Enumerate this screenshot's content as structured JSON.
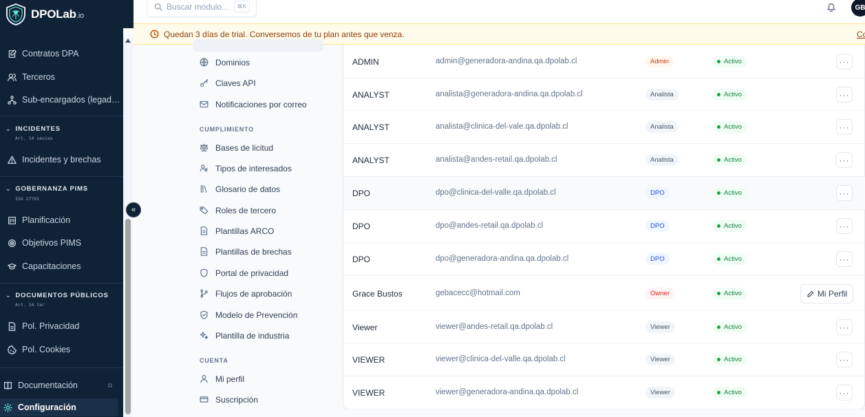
{
  "brand": {
    "name": "DPOLab",
    "suffix": ".io"
  },
  "search": {
    "placeholder": "Buscar módulo...",
    "shortcut": "⌘K"
  },
  "user": {
    "initials": "GB"
  },
  "banner": {
    "text": "Quedan 3 días de trial. Conversemos de tu plan antes que venza.",
    "link": "Con"
  },
  "sidebar": {
    "items_top": [
      {
        "label": "Contratos DPA",
        "icon": "edit-doc-icon"
      },
      {
        "label": "Terceros",
        "icon": "users-icon"
      },
      {
        "label": "Sub-encargados (legad…",
        "icon": "network-icon"
      }
    ],
    "sections": [
      {
        "title": "INCIDENTES",
        "sub": "Art. 14 sexies",
        "items": [
          {
            "label": "Incidentes y brechas",
            "icon": "warning-icon"
          }
        ]
      },
      {
        "title": "GOBERNANZA PIMS",
        "sub": "ISO 27701",
        "items": [
          {
            "label": "Planificación",
            "icon": "calendar-icon"
          },
          {
            "label": "Objetivos PIMS",
            "icon": "target-icon"
          },
          {
            "label": "Capacitaciones",
            "icon": "graduation-icon"
          }
        ]
      },
      {
        "title": "DOCUMENTOS PÚBLICOS",
        "sub": "Art. 14 ter",
        "items": [
          {
            "label": "Pol. Privacidad",
            "icon": "document-icon"
          },
          {
            "label": "Pol. Cookies",
            "icon": "cookie-icon"
          }
        ]
      }
    ],
    "bottom": [
      {
        "label": "Documentación",
        "icon": "book-icon"
      },
      {
        "label": "Configuración",
        "icon": "gear-icon"
      }
    ]
  },
  "settings_nav": {
    "general_items": [
      {
        "label": "Dominios",
        "icon": "globe-icon"
      },
      {
        "label": "Claves API",
        "icon": "key-icon"
      },
      {
        "label": "Notificaciones por correo",
        "icon": "mail-icon"
      }
    ],
    "cumplimiento_title": "CUMPLIMIENTO",
    "cumplimiento_items": [
      {
        "label": "Bases de licitud",
        "icon": "scale-icon"
      },
      {
        "label": "Tipos de interesados",
        "icon": "people-icon"
      },
      {
        "label": "Glosario de datos",
        "icon": "library-icon"
      },
      {
        "label": "Roles de tercero",
        "icon": "tag-icon"
      },
      {
        "label": "Plantillas ARCO",
        "icon": "file-icon"
      },
      {
        "label": "Plantillas de brechas",
        "icon": "file-icon"
      },
      {
        "label": "Portal de privacidad",
        "icon": "shield-icon"
      },
      {
        "label": "Flujos de aprobación",
        "icon": "git-branch-icon"
      },
      {
        "label": "Modelo de Prevención",
        "icon": "shield-check-icon"
      },
      {
        "label": "Plantilla de industria",
        "icon": "sparkles-icon"
      }
    ],
    "cuenta_title": "CUENTA",
    "cuenta_items": [
      {
        "label": "Mi perfil",
        "icon": "user-icon"
      },
      {
        "label": "Suscripción",
        "icon": "credit-card-icon"
      }
    ]
  },
  "users": [
    {
      "name": "ADMIN",
      "email": "admin@generadora-andina.qa.dpolab.cl",
      "role": "Admin",
      "role_class": "b-admin",
      "status": "Activo",
      "action": "more"
    },
    {
      "name": "ANALYST",
      "email": "analista@generadora-andina.qa.dpolab.cl",
      "role": "Analista",
      "role_class": "b-analyst",
      "status": "Activo",
      "action": "more"
    },
    {
      "name": "ANALYST",
      "email": "analista@clinica-del-vale.qa.dpolab.cl",
      "role": "Analista",
      "role_class": "b-analyst",
      "status": "Activo",
      "action": "more"
    },
    {
      "name": "ANALYST",
      "email": "analista@andes-retail.qa.dpolab.cl",
      "role": "Analista",
      "role_class": "b-analyst",
      "status": "Activo",
      "action": "more"
    },
    {
      "name": "DPO",
      "email": "dpo@clinica-del-valle.qa.dpolab.cl",
      "role": "DPO",
      "role_class": "b-dpo",
      "status": "Activo",
      "action": "more"
    },
    {
      "name": "DPO",
      "email": "dpo@andes-retail.qa.dpolab.cl",
      "role": "DPO",
      "role_class": "b-dpo",
      "status": "Activo",
      "action": "more"
    },
    {
      "name": "DPO",
      "email": "dpo@generadora-andina.qa.dpolab.cl",
      "role": "DPO",
      "role_class": "b-dpo",
      "status": "Activo",
      "action": "more"
    },
    {
      "name": "Grace Bustos",
      "email": "gebacecc@hotmail.com",
      "role": "Owner",
      "role_class": "b-owner",
      "status": "Activo",
      "action": "Mi Perfil"
    },
    {
      "name": "Viewer",
      "email": "viewer@andes-retail.qa.dpolab.cl",
      "role": "Viewer",
      "role_class": "b-viewer",
      "status": "Activo",
      "action": "more"
    },
    {
      "name": "VIEWER",
      "email": "viewer@clinica-del-valle.qa.dpolab.cl",
      "role": "Viewer",
      "role_class": "b-viewer",
      "status": "Activo",
      "action": "more"
    },
    {
      "name": "VIEWER",
      "email": "viewer@generadora-andina.qa.dpolab.cl",
      "role": "Viewer",
      "role_class": "b-viewer",
      "status": "Activo",
      "action": "more"
    }
  ]
}
